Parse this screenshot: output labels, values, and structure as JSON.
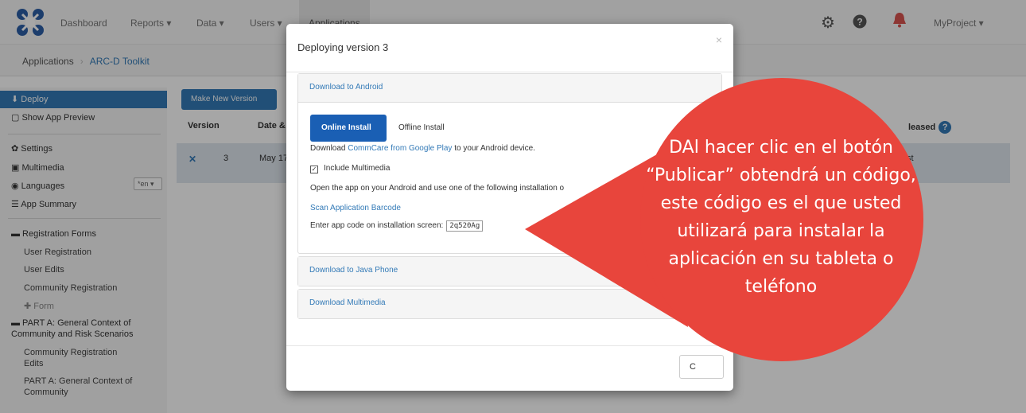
{
  "navbar": {
    "items": [
      "Dashboard",
      "Reports ▾",
      "Data ▾",
      "Users ▾",
      "Applications"
    ],
    "project": "MyProject ▾"
  },
  "breadcrumb": {
    "root": "Applications",
    "current": "ARC-D Toolkit"
  },
  "sidebar": {
    "deploy": "⬇ Deploy",
    "preview": "▢ Show App Preview",
    "settings": "✿ Settings",
    "multimedia": "▣ Multimedia",
    "languages": "◉ Languages",
    "lang_value": "*en ▾",
    "summary": "☰ App Summary",
    "registration_forms": "▬ Registration Forms",
    "user_registration": "User Registration",
    "user_edits": "User Edits",
    "community_registration": "Community Registration",
    "add_form": "✚ Form",
    "part_a_1": "▬ PART A: General Context of",
    "part_a_2": "Community and Risk Scenarios",
    "cr_edits_1": "Community Registration",
    "cr_edits_2": "Edits",
    "part_a_sub_1": "PART A: General Context of",
    "part_a_sub_2": "Community"
  },
  "main": {
    "make_new_version": "Make New Version",
    "headers": {
      "version": "Version",
      "date": "Date &",
      "released": "leased"
    },
    "row": {
      "x": "✕",
      "version": "3",
      "date": "May 17",
      "status": "st"
    }
  },
  "modal": {
    "title": "Deploying version 3",
    "close_x": "×",
    "panel_android": "Download to Android",
    "online_install": "Online Install",
    "offline_install": "Offline Install",
    "download_prefix": "Download",
    "commcare_link": "CommCare from Google Play",
    "download_suffix": "to your Android device.",
    "include_multimedia": "Include Multimedia",
    "open_app_text": "Open the app on your Android and use one of the following installation o",
    "scan_barcode": "Scan Application Barcode",
    "enter_code_text": "Enter app code on installation screen:",
    "app_code": "2q520Ag",
    "panel_java": "Download to Java Phone",
    "panel_multimedia": "Download Multimedia",
    "close_button": "C"
  },
  "callout": {
    "text": "DAl hacer clic en el botón “Publicar” obtendrá un código, este código es el que usted utilizará para instalar la aplicación en su tableta o teléfono",
    "color": "#e8453c"
  }
}
